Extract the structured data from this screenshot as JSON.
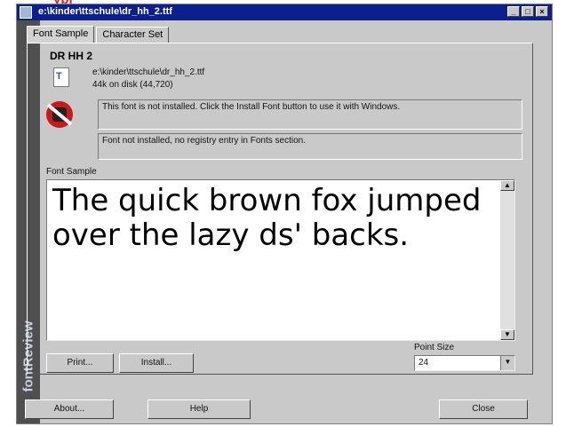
{
  "page": {
    "banner_text": "ypi"
  },
  "window": {
    "title": "e:\\kinder\\ttschule\\dr_hh_2.ttf",
    "controls": [
      "_",
      "□",
      "×"
    ]
  },
  "tabs": [
    {
      "label": "Font Sample"
    },
    {
      "label": "Character Set"
    }
  ],
  "font_info": {
    "name": "DR HH 2",
    "path": "e:\\kinder\\ttschule\\dr_hh_2.ttf",
    "size": "44k on disk (44,720)",
    "icon_glyph": "T"
  },
  "messages": {
    "install_msg": "This font is not installed. Click the Install Font button to use it with Windows.",
    "registry_msg": "Font not installed, no registry entry in Fonts section."
  },
  "sample": {
    "label": "Font Sample",
    "text": "The quick brown fox jumped over the lazy ds' backs."
  },
  "buttons": {
    "print": "Print...",
    "install": "Install...",
    "about": "About...",
    "help": "Help",
    "close": "Close"
  },
  "point_size": {
    "label": "Point Size",
    "value": "24"
  },
  "sidebar": {
    "brand": "fontReview"
  },
  "colors": {
    "title_bar": "#0b1f8f",
    "window_bg": "#c9c9c9",
    "sidebar": "#4f4f4f"
  }
}
